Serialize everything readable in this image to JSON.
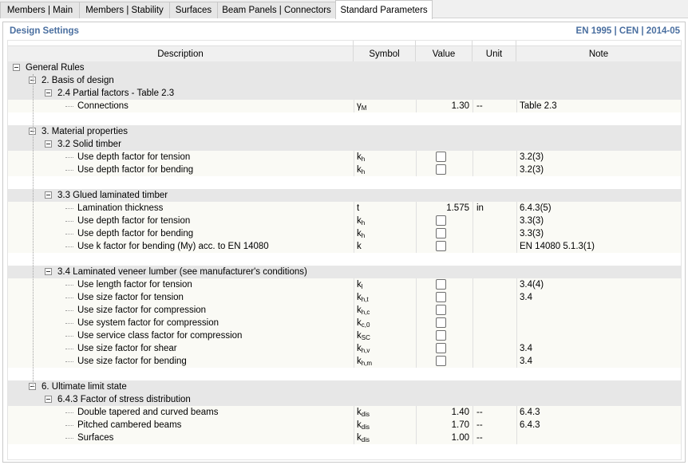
{
  "tabs": [
    {
      "label": "Members | Main",
      "active": false
    },
    {
      "label": "Members | Stability",
      "active": false
    },
    {
      "label": "Surfaces",
      "active": false
    },
    {
      "label": "Beam Panels | Connectors",
      "active": false
    },
    {
      "label": "Standard Parameters",
      "active": true
    }
  ],
  "panel": {
    "title": "Design Settings",
    "standard": "EN 1995 | CEN | 2014-05"
  },
  "columns": {
    "description": "Description",
    "symbol": "Symbol",
    "value": "Value",
    "unit": "Unit",
    "note": "Note"
  },
  "tree": {
    "general_rules": "General Rules",
    "basis": "2. Basis of design",
    "partial_factors": "2.4 Partial factors - Table 2.3",
    "connections": {
      "desc": "Connections",
      "sym": "γ",
      "sub": "M",
      "value": "1.30",
      "unit": "--",
      "note": "Table 2.3"
    },
    "material": "3. Material properties",
    "solid_timber": "3.2 Solid timber",
    "solid_rows": [
      {
        "desc": "Use depth factor for tension",
        "sym": "k",
        "sub": "h",
        "note": "3.2(3)"
      },
      {
        "desc": "Use depth factor for bending",
        "sym": "k",
        "sub": "h",
        "note": "3.2(3)"
      }
    ],
    "glulam": "3.3 Glued laminated timber",
    "lamination": {
      "desc": "Lamination thickness",
      "sym": "t",
      "sub": "",
      "value": "1.575",
      "unit": "in",
      "note": "6.4.3(5)"
    },
    "glulam_rows": [
      {
        "desc": "Use depth factor for tension",
        "sym": "k",
        "sub": "h",
        "note": "3.3(3)"
      },
      {
        "desc": "Use depth factor for bending",
        "sym": "k",
        "sub": "h",
        "note": "3.3(3)"
      },
      {
        "desc": "Use k factor for bending (My) acc. to EN 14080",
        "sym": "k",
        "sub": "",
        "note": "EN 14080 5.1.3(1)"
      }
    ],
    "lvl": "3.4 Laminated veneer lumber (see manufacturer's conditions)",
    "lvl_rows": [
      {
        "desc": "Use length factor for tension",
        "sym": "k",
        "sub": "l",
        "note": "3.4(4)"
      },
      {
        "desc": "Use size factor for tension",
        "sym": "k",
        "sub": "h,t",
        "note": "3.4"
      },
      {
        "desc": "Use size factor for compression",
        "sym": "k",
        "sub": "h,c",
        "note": ""
      },
      {
        "desc": "Use system factor for compression",
        "sym": "k",
        "sub": "c,0",
        "note": ""
      },
      {
        "desc": "Use service class factor for compression",
        "sym": "k",
        "sub": "SC",
        "note": ""
      },
      {
        "desc": "Use size factor for shear",
        "sym": "k",
        "sub": "h,v",
        "note": "3.4"
      },
      {
        "desc": "Use size factor for bending",
        "sym": "k",
        "sub": "h,m",
        "note": "3.4"
      }
    ],
    "uls": "6. Ultimate limit state",
    "stress_dist": "6.4.3 Factor of stress distribution",
    "stress_rows": [
      {
        "desc": "Double tapered and curved beams",
        "sym": "k",
        "sub": "dis",
        "value": "1.40",
        "unit": "--",
        "note": "6.4.3"
      },
      {
        "desc": "Pitched cambered beams",
        "sym": "k",
        "sub": "dis",
        "value": "1.70",
        "unit": "--",
        "note": "6.4.3"
      },
      {
        "desc": "Surfaces",
        "sym": "k",
        "sub": "dis",
        "value": "1.00",
        "unit": "--",
        "note": ""
      }
    ]
  },
  "colors": {
    "accent": "#4a6fa0",
    "group_bg": "#e7e7e7",
    "row_bg": "#fafaf5"
  }
}
